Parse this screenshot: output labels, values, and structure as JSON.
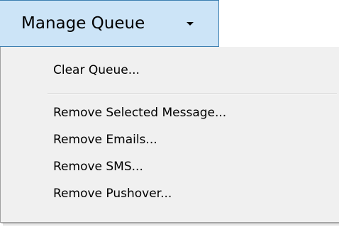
{
  "button": {
    "label": "Manage Queue",
    "icon": "caret-down-icon"
  },
  "menu": {
    "items": [
      {
        "label": "Clear Queue..."
      },
      {
        "label": "Remove Selected Message..."
      },
      {
        "label": "Remove Emails..."
      },
      {
        "label": "Remove SMS..."
      },
      {
        "label": "Remove Pushover..."
      }
    ]
  },
  "colors": {
    "button_bg": "#cce4f7",
    "button_border": "#3c7fb1",
    "menu_bg": "#f0f0f0",
    "menu_border": "#a0a0a0",
    "separator": "#d7d7d7",
    "text": "#000000"
  }
}
